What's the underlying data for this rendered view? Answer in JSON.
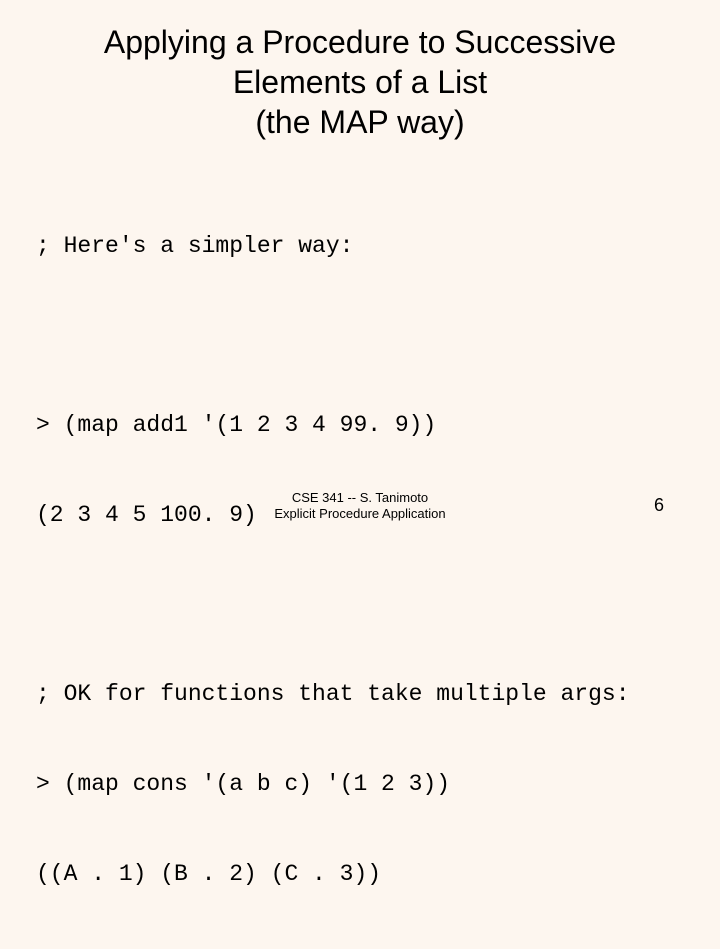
{
  "title_line1": "Applying a Procedure to Successive",
  "title_line2": "Elements of a List",
  "title_line3": "(the MAP way)",
  "block1_line1": "; Here's a simpler way:",
  "block2_line1": "> (map add1 '(1 2 3 4 99. 9))",
  "block2_line2": "(2 3 4 5 100. 9)",
  "block3_line1": "; OK for functions that take multiple args:",
  "block3_line2": "> (map cons '(a b c) '(1 2 3))",
  "block3_line3": "((A . 1) (B . 2) (C . 3))",
  "footer_line1": "CSE 341 -- S. Tanimoto",
  "footer_line2": "Explicit Procedure Application",
  "page_number": "6"
}
